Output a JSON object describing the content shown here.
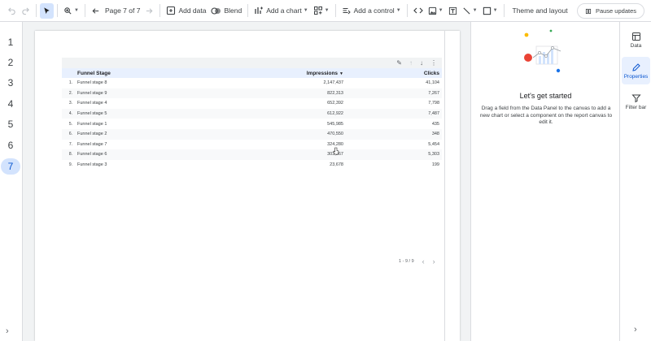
{
  "toolbar": {
    "page_indicator": "Page 7 of 7",
    "add_data": "Add data",
    "blend": "Blend",
    "add_chart": "Add a chart",
    "add_control": "Add a control",
    "theme_layout": "Theme and layout",
    "pause_updates": "Pause updates"
  },
  "pages": [
    "1",
    "2",
    "3",
    "4",
    "5",
    "6",
    "7"
  ],
  "current_page": "7",
  "table": {
    "headers": {
      "stage": "Funnel Stage",
      "impressions": "Impressions",
      "clicks": "Clicks"
    },
    "rows": [
      {
        "idx": "1.",
        "stage": "Funnel stage 8",
        "impressions": "2,147,437",
        "clicks": "41,104"
      },
      {
        "idx": "2.",
        "stage": "Funnel stage 9",
        "impressions": "822,313",
        "clicks": "7,267"
      },
      {
        "idx": "3.",
        "stage": "Funnel stage 4",
        "impressions": "652,392",
        "clicks": "7,798"
      },
      {
        "idx": "4.",
        "stage": "Funnel stage 5",
        "impressions": "612,922",
        "clicks": "7,487"
      },
      {
        "idx": "5.",
        "stage": "Funnel stage 1",
        "impressions": "545,985",
        "clicks": "435"
      },
      {
        "idx": "6.",
        "stage": "Funnel stage 2",
        "impressions": "470,550",
        "clicks": "348"
      },
      {
        "idx": "7.",
        "stage": "Funnel stage 7",
        "impressions": "324,280",
        "clicks": "5,454"
      },
      {
        "idx": "8.",
        "stage": "Funnel stage 6",
        "impressions": "303,267",
        "clicks": "5,303"
      },
      {
        "idx": "9.",
        "stage": "Funnel stage 3",
        "impressions": "23,678",
        "clicks": "199"
      }
    ],
    "pagination": "1 - 9 / 9"
  },
  "properties": {
    "title": "Let's get started",
    "description": "Drag a field from the Data Panel to the canvas to add a new chart or select a component on the report canvas to edit it."
  },
  "side_tabs": {
    "data": "Data",
    "properties": "Properties",
    "filter_bar": "Filter bar"
  },
  "colors": {
    "accent": "#0b57d0",
    "active_bg": "#d3e3fd",
    "header_bg": "#e8f0fe"
  }
}
